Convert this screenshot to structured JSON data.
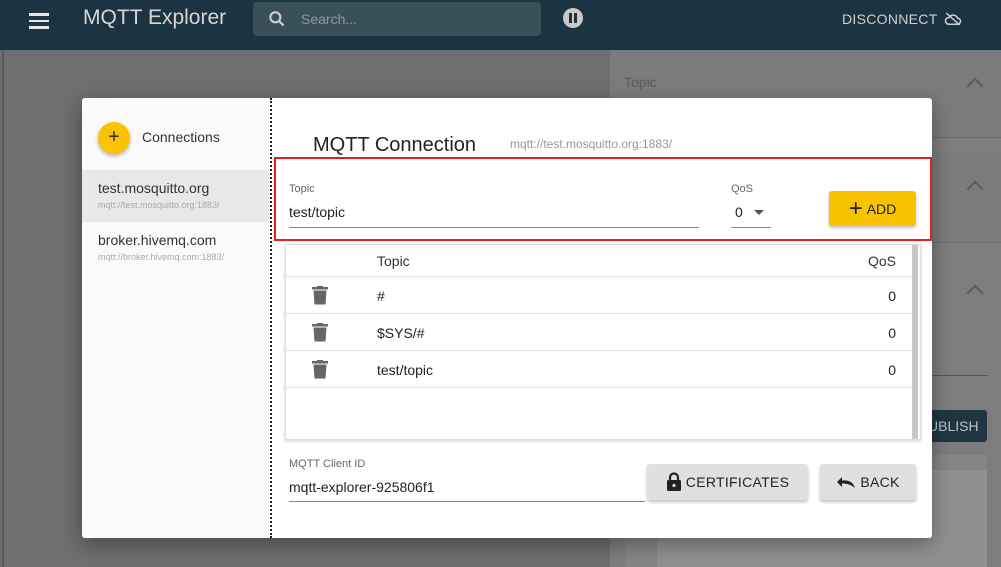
{
  "appbar": {
    "title": "MQTT Explorer",
    "search_placeholder": "Search...",
    "disconnect_label": "DISCONNECT"
  },
  "background": {
    "topic_label": "Topic",
    "publish_label": "UBLISH"
  },
  "connections": {
    "header": "Connections",
    "add_symbol": "+",
    "items": [
      {
        "name": "test.mosquitto.org",
        "url": "mqtt://test.mosquitto.org:1883/",
        "selected": true
      },
      {
        "name": "broker.hivemq.com",
        "url": "mqtt://broker.hivemq.com:1883/",
        "selected": false
      }
    ]
  },
  "dialog": {
    "title": "MQTT Connection",
    "url": "mqtt://test.mosquitto.org:1883/",
    "subscribe": {
      "topic_label": "Topic",
      "topic_value": "test/topic",
      "qos_label": "QoS",
      "qos_value": "0",
      "add_label": "ADD"
    },
    "table": {
      "headers": {
        "topic": "Topic",
        "qos": "QoS"
      },
      "rows": [
        {
          "topic": "#",
          "qos": "0"
        },
        {
          "topic": "$SYS/#",
          "qos": "0"
        },
        {
          "topic": "test/topic",
          "qos": "0"
        }
      ]
    },
    "client_id": {
      "label": "MQTT Client ID",
      "value": "mqtt-explorer-925806f1"
    },
    "certificates_label": "CERTIFICATES",
    "back_label": "BACK"
  },
  "colors": {
    "accent": "#f9c300",
    "appbar": "#1c3441",
    "highlight": "#e02020"
  }
}
